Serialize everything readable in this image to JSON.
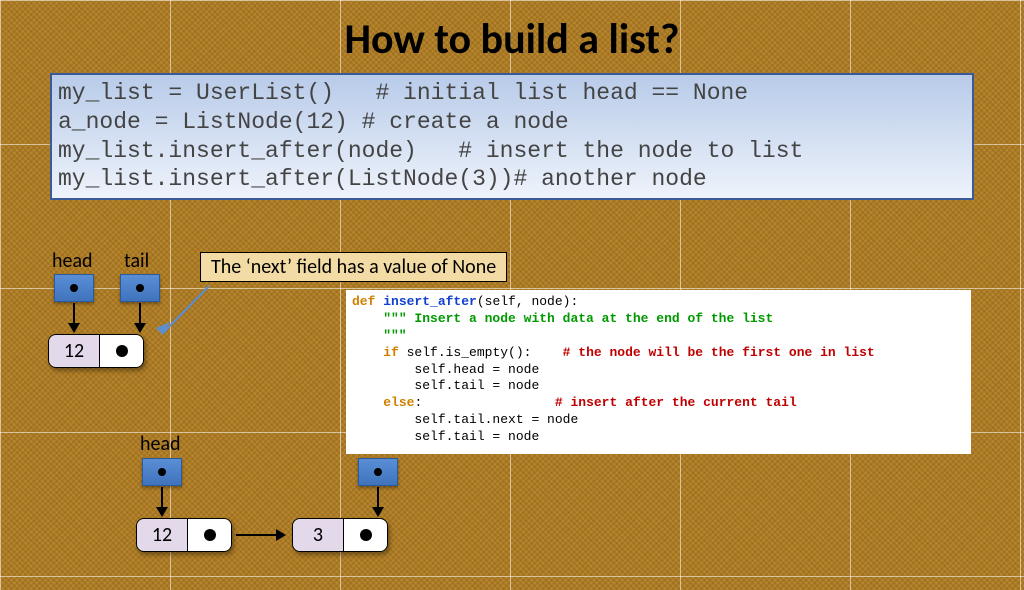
{
  "title": "How to build a list?",
  "code": {
    "l1": "my_list = UserList()   # initial list head == None",
    "l2": "a_node = ListNode(12) # create a node",
    "l3": "my_list.insert_after(node)   # insert the node to list",
    "l4": "my_list.insert_after(ListNode(3))# another node"
  },
  "note": "The ‘next’ field has a value of None",
  "labels": {
    "head": "head",
    "tail": "tail"
  },
  "diagram1": {
    "value": "12"
  },
  "diagram2": {
    "v1": "12",
    "v2": "3"
  },
  "func": {
    "def": "def ",
    "name": "insert_after",
    "sig": "(self, node):",
    "doc": "\"\"\" Insert a node with data at the end of the list\n    \"\"\"",
    "if": "if ",
    "cond": "self.is_empty():",
    "c1": "# the node will be the first one in list",
    "b1": "self.head = node",
    "b2": "self.tail = node",
    "else": "else",
    "colon": ":",
    "c2": "# insert after the current tail",
    "b3": "self.tail.next = node",
    "b4": "self.tail = node"
  }
}
